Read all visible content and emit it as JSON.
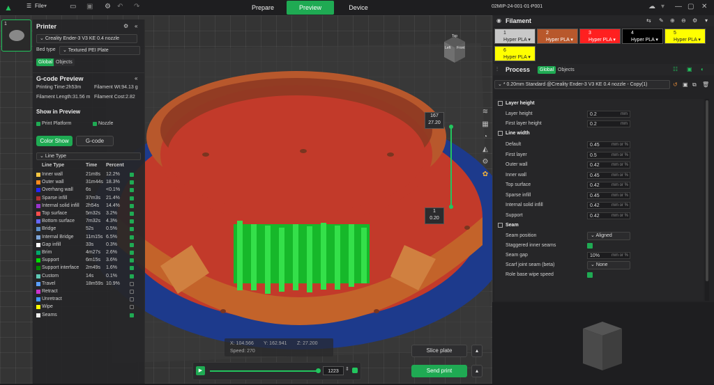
{
  "topbar": {
    "file_label": "File",
    "tabs": [
      {
        "label": "Prepare"
      },
      {
        "label": "Preview"
      },
      {
        "label": "Device"
      }
    ],
    "project_name": "02MIP-24-001-01-P001"
  },
  "printer": {
    "title": "Printer",
    "thumb_number": "1",
    "printer_name": "Creality Ender-3 V3 KE 0.4 nozzle",
    "bed_type_label": "Bed type",
    "bed_type_value": "Textured PEI Plate",
    "scope_global": "Global",
    "scope_objects": "Objects"
  },
  "gcode": {
    "title": "G-code Preview",
    "printing_time": "Printing Time:2h53m",
    "filament_wt": "Filament Wt:94.13 g",
    "filament_length": "Filament Length:31.56 m",
    "filament_cost": "Filament Cost:2.82",
    "show_in_preview": "Show in Preview",
    "print_platform": "Print Platform",
    "nozzle": "Nozzle",
    "color_show": "Color Show",
    "gcode_btn": "G-code",
    "line_type_select": "Line Type",
    "col_line_type": "Line Type",
    "col_time": "Time",
    "col_percent": "Percent",
    "rows": [
      {
        "name": "Inner wall",
        "time": "21m8s",
        "percent": "12.2%",
        "color": "#f5c542",
        "checked": true
      },
      {
        "name": "Outer wall",
        "time": "31m44s",
        "percent": "18.3%",
        "color": "#ff8a1c",
        "checked": true
      },
      {
        "name": "Overhang wall",
        "time": "6s",
        "percent": "<0.1%",
        "color": "#2424ff",
        "checked": true
      },
      {
        "name": "Sparse infill",
        "time": "37m3s",
        "percent": "21.4%",
        "color": "#b33030",
        "checked": true
      },
      {
        "name": "Internal solid infill",
        "time": "2h54s",
        "percent": "14.4%",
        "color": "#9933cc",
        "checked": true
      },
      {
        "name": "Top surface",
        "time": "5m32s",
        "percent": "3.2%",
        "color": "#ff4d4d",
        "checked": true
      },
      {
        "name": "Bottom surface",
        "time": "7m32s",
        "percent": "4.3%",
        "color": "#6666ff",
        "checked": true
      },
      {
        "name": "Bridge",
        "time": "52s",
        "percent": "0.5%",
        "color": "#5b8fc9",
        "checked": true
      },
      {
        "name": "Internal Bridge",
        "time": "11m15s",
        "percent": "6.5%",
        "color": "#7ea6d9",
        "checked": true
      },
      {
        "name": "Gap infill",
        "time": "33s",
        "percent": "0.3%",
        "color": "#ffffff",
        "checked": true
      },
      {
        "name": "Brim",
        "time": "4m27s",
        "percent": "2.6%",
        "color": "#00a86b",
        "checked": true
      },
      {
        "name": "Support",
        "time": "6m15s",
        "percent": "3.6%",
        "color": "#00e000",
        "checked": true
      },
      {
        "name": "Support interface",
        "time": "2m49s",
        "percent": "1.6%",
        "color": "#008800",
        "checked": true
      },
      {
        "name": "Custom",
        "time": "14s",
        "percent": "0.1%",
        "color": "#5ec9b5",
        "checked": true
      },
      {
        "name": "Travel",
        "time": "18m59s",
        "percent": "10.9%",
        "color": "#5aa0ff",
        "checked": false
      },
      {
        "name": "Retract",
        "time": "",
        "percent": "",
        "color": "#cc33cc",
        "checked": false
      },
      {
        "name": "Unretract",
        "time": "",
        "percent": "",
        "color": "#4499ff",
        "checked": false
      },
      {
        "name": "Wipe",
        "time": "",
        "percent": "",
        "color": "#ffff00",
        "checked": false
      },
      {
        "name": "Seams",
        "time": "",
        "percent": "",
        "color": "#f0f0f0",
        "checked": true
      }
    ]
  },
  "viewport": {
    "layer_top": "167",
    "layer_top_z": "27.20",
    "layer_bottom": "1",
    "layer_bottom_z": "0.20",
    "cube_top": "Top",
    "cube_left": "Left",
    "cube_front": "Front",
    "coord_x": "X: 104.566",
    "coord_y": "Y: 162.941",
    "coord_z": "Z: 27.200",
    "speed": "Speed: 270",
    "layer_value": "1223",
    "slice_plate": "Slice plate",
    "send_print": "Send print"
  },
  "filament": {
    "title": "Filament",
    "slots": [
      {
        "num": "1",
        "name": "Hyper PLA",
        "color": "#c8c8c8",
        "text": "#222"
      },
      {
        "num": "2",
        "name": "Hyper PLA",
        "color": "#b8582c",
        "text": "#fff"
      },
      {
        "num": "3",
        "name": "Hyper PLA",
        "color": "#ff2020",
        "text": "#fff"
      },
      {
        "num": "4",
        "name": "Hyper PLA",
        "color": "#000000",
        "text": "#fff"
      },
      {
        "num": "5",
        "name": "Hyper PLA",
        "color": "#ffff00",
        "text": "#222"
      },
      {
        "num": "6",
        "name": "Hyper PLA",
        "color": "#ffff00",
        "text": "#222"
      }
    ]
  },
  "process": {
    "title": "Process",
    "scope_global": "Global",
    "scope_objects": "Objects",
    "profile": "* 0.20mm Standard @Creality Ender-3 V3 KE 0.4 nozzle - Copy(1)",
    "layer_height_group": "Layer height",
    "layer_height_label": "Layer height",
    "layer_height_value": "0.2",
    "first_layer_height_label": "First layer height",
    "first_layer_height_value": "0.2",
    "unit_mm": "mm",
    "line_width_group": "Line width",
    "unit_mm_or_pct": "mm or %",
    "line_widths": [
      {
        "label": "Default",
        "value": "0.45"
      },
      {
        "label": "First layer",
        "value": "0.5"
      },
      {
        "label": "Outer wall",
        "value": "0.42"
      },
      {
        "label": "Inner wall",
        "value": "0.45"
      },
      {
        "label": "Top surface",
        "value": "0.42"
      },
      {
        "label": "Sparse infill",
        "value": "0.45"
      },
      {
        "label": "Internal solid infill",
        "value": "0.42"
      },
      {
        "label": "Support",
        "value": "0.42"
      }
    ],
    "seam_group": "Seam",
    "seam_position_label": "Seam position",
    "seam_position_value": "Aligned",
    "staggered_label": "Staggered inner seams",
    "seam_gap_label": "Seam gap",
    "seam_gap_value": "10%",
    "scarf_label": "Scarf joint seam (beta)",
    "scarf_value": "None",
    "role_wipe_label": "Role base wipe speed"
  }
}
